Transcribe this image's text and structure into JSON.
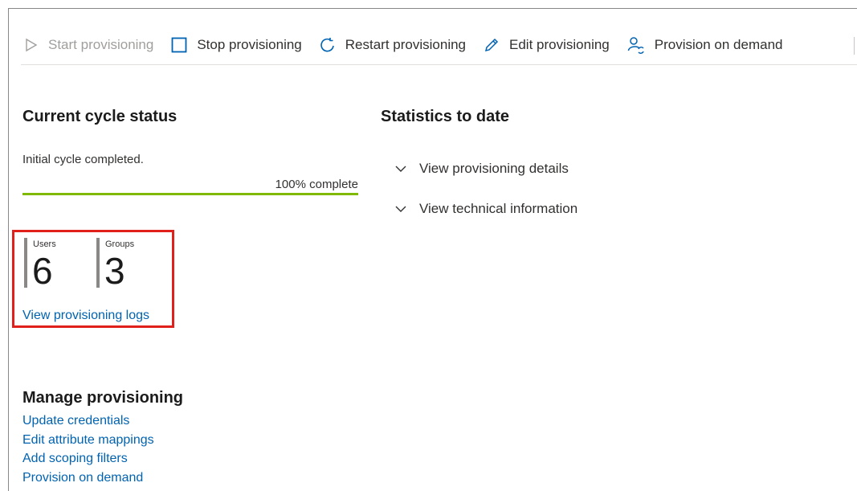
{
  "toolbar": {
    "start_label": "Start provisioning",
    "stop_label": "Stop provisioning",
    "restart_label": "Restart provisioning",
    "edit_label": "Edit provisioning",
    "ondemand_label": "Provision on demand"
  },
  "cycle": {
    "title": "Current cycle status",
    "message": "Initial cycle completed.",
    "progress_label": "100% complete",
    "progress_fraction": 1.0,
    "users_label": "Users",
    "users_count": "6",
    "groups_label": "Groups",
    "groups_count": "3",
    "logs_link": "View provisioning logs"
  },
  "stats": {
    "title": "Statistics to date",
    "details_label": "View provisioning details",
    "technical_label": "View technical information"
  },
  "manage": {
    "title": "Manage provisioning",
    "links": [
      "Update credentials",
      "Edit attribute mappings",
      "Add scoping filters",
      "Provision on demand"
    ]
  },
  "colors": {
    "accent": "#0063b1",
    "progress": "#7fba00",
    "highlight": "#e0201b"
  },
  "icons": {
    "start": "play-icon",
    "stop": "stop-square-icon",
    "restart": "restart-icon",
    "edit": "pencil-icon",
    "ondemand": "user-sync-icon",
    "expand": "chevron-down-icon"
  }
}
